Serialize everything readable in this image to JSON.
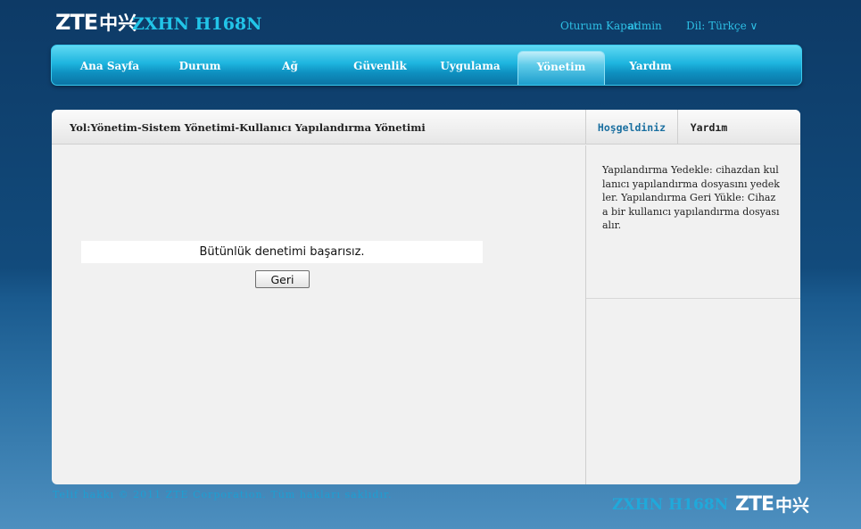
{
  "header": {
    "logo_text": "ZTE",
    "logo_cn": "中兴",
    "model": "ZXHN H168N",
    "logout_label": "Oturum Kapat",
    "username": "admin",
    "language_label": "Dil: Türkçe ∨"
  },
  "nav": {
    "items": [
      {
        "label": "Ana Sayfa"
      },
      {
        "label": "Durum"
      },
      {
        "label": "Ağ"
      },
      {
        "label": "Güvenlik"
      },
      {
        "label": "Uygulama"
      },
      {
        "label": "Yönetim",
        "active": true
      },
      {
        "label": "Yardım"
      }
    ]
  },
  "panel": {
    "breadcrumb": "Yol:Yönetim-Sistem Yönetimi-Kullanıcı Yapılandırma Yönetimi",
    "tab_welcome": "Hoşgeldiniz",
    "tab_help": "Yardım",
    "message": "Bütünlük denetimi başarısız.",
    "back_button": "Geri",
    "help_text": "Yapılandırma Yedekle: cihazdan kullanıcı yapılandırma dosyasını yedekler. Yapılandırma Geri Yükle: Cihaza bir kullanıcı yapılandırma dosyası alır."
  },
  "footer": {
    "copyright": "Telif hakkı © 2011 ZTE Corporation. Tüm hakları saklıdır.",
    "model": "ZXHN H168N",
    "logo_text": "ZTE",
    "logo_cn": "中兴"
  },
  "colors": {
    "accent": "#22c5e8",
    "nav_gradient_top": "#5fd9f3",
    "nav_gradient_bottom": "#0b74a4",
    "background_top": "#0d3a66",
    "background_bottom": "#4d8fbf"
  }
}
